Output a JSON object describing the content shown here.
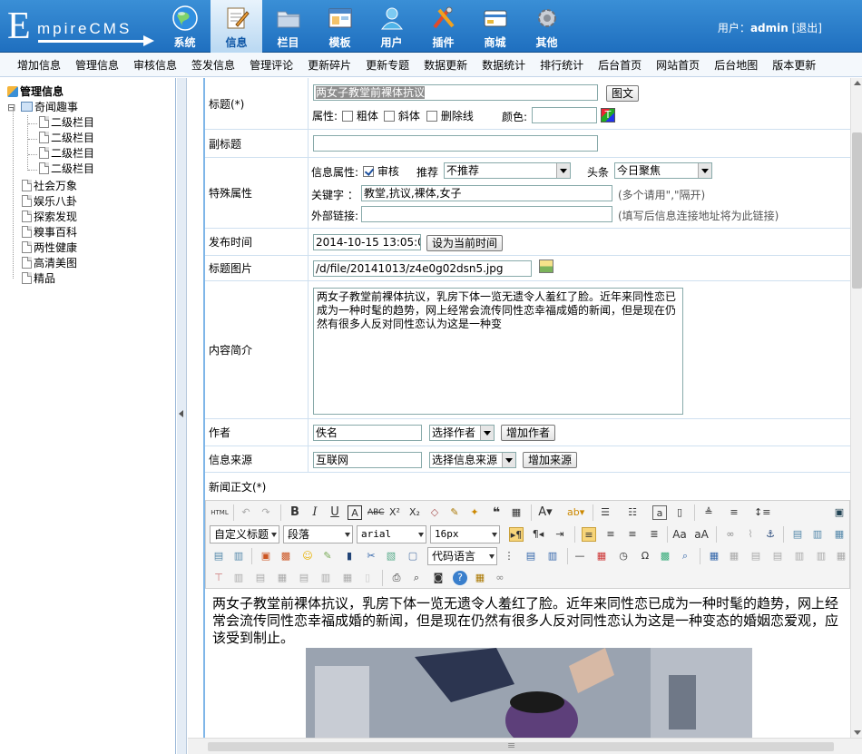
{
  "brand": {
    "logo_big": "E",
    "logo_small": "mpireCMS"
  },
  "nav": [
    {
      "label": "系统",
      "icon": "globe-icon",
      "active": false
    },
    {
      "label": "信息",
      "icon": "note-pencil-icon",
      "active": true
    },
    {
      "label": "栏目",
      "icon": "folder-icon",
      "active": false
    },
    {
      "label": "模板",
      "icon": "window-icon",
      "active": false
    },
    {
      "label": "用户",
      "icon": "user-icon",
      "active": false
    },
    {
      "label": "插件",
      "icon": "tools-icon",
      "active": false
    },
    {
      "label": "商城",
      "icon": "card-icon",
      "active": false
    },
    {
      "label": "其他",
      "icon": "gear-icon",
      "active": false
    }
  ],
  "user": {
    "prefix": "用户：",
    "name": "admin",
    "logout": "[退出]"
  },
  "menu": [
    "增加信息",
    "管理信息",
    "审核信息",
    "签发信息",
    "管理评论",
    "更新碎片",
    "更新专题",
    "数据更新",
    "数据统计",
    "排行统计",
    "后台首页",
    "网站首页",
    "后台地图",
    "版本更新"
  ],
  "tree": {
    "root": "管理信息",
    "expanded": "奇闻趣事",
    "children": [
      "二级栏目",
      "二级栏目",
      "二级栏目",
      "二级栏目"
    ],
    "others": [
      "社会万象",
      "娱乐八卦",
      "探索发现",
      "糗事百科",
      "两性健康",
      "高清美图",
      "精品"
    ],
    "toggle": "⊟"
  },
  "form": {
    "title_label": "标题(*)",
    "title_value": "两女子教堂前裸体抗议",
    "title_btn": "图文",
    "attr_label": "属性:",
    "bold": "粗体",
    "italic": "斜体",
    "strike": "删除线",
    "color_label": "颜色:",
    "subtitle_label": "副标题",
    "special_label": "特殊属性",
    "info_attr": "信息属性:",
    "review": "审核",
    "recommend_label": "推荐",
    "recommend_value": "不推荐",
    "headline_label": "头条",
    "headline_value": "今日聚焦",
    "keyword_label": "关键字 ：",
    "keyword_value": "教堂,抗议,裸体,女子",
    "keyword_hint": "(多个请用\",\"隔开)",
    "extlink_label": "外部链接:",
    "extlink_hint": "(填写后信息连接地址将为此链接)",
    "pubtime_label": "发布时间",
    "pubtime_value": "2014-10-15 13:05:01",
    "pubtime_btn": "设为当前时间",
    "titlepic_label": "标题图片",
    "titlepic_value": "/d/file/20141013/z4e0g02dsn5.jpg",
    "summary_label": "内容简介",
    "summary_value": "两女子教堂前裸体抗议，乳房下体一览无遗令人羞红了脸。近年来同性恋已成为一种时髦的趋势，网上经常会流传同性恋幸福成婚的新闻，但是现在仍然有很多人反对同性恋认为这是一种变",
    "author_label": "作者",
    "author_value": "佚名",
    "author_select": "选择作者",
    "author_btn": "增加作者",
    "source_label": "信息来源",
    "source_value": "互联网",
    "source_select": "选择信息来源",
    "source_btn": "增加来源",
    "body_label": "新闻正文(*)"
  },
  "toolbar": {
    "style": "自定义标题",
    "format": "段落",
    "font": "arial",
    "size": "16px",
    "code": "代码语言",
    "html": "HTML"
  },
  "editor": {
    "text": "两女子教堂前裸体抗议，乳房下体一览无遗令人羞红了脸。近年来同性恋已成为一种时髦的趋势，网上经常会流传同性恋幸福成婚的新闻，但是现在仍然有很多人反对同性恋认为这是一种变态的婚姻恋爱观，应该受到制止。"
  },
  "colors": {
    "header": "#2a7fcf",
    "active_tab": "#d6e9f8",
    "form_line": "#cfe0f0"
  }
}
